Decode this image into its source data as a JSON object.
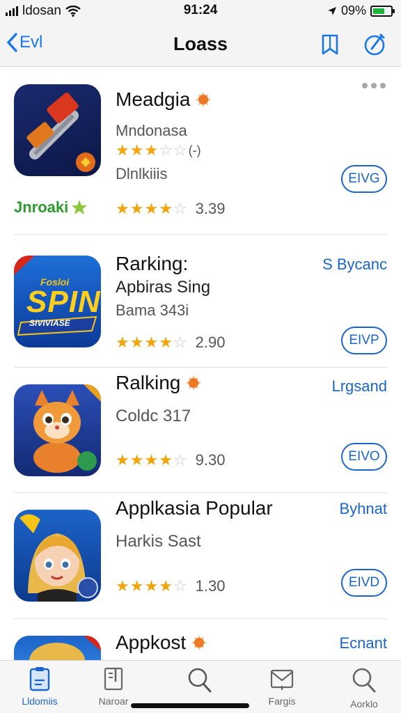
{
  "status_bar": {
    "carrier": "ldosan",
    "time": "91:24",
    "battery": "09%",
    "battery_level": 0.65
  },
  "nav": {
    "back_label": "Evl",
    "title": "Loass",
    "book_icon": "book-icon",
    "compose_icon": "compose-icon"
  },
  "apps": [
    {
      "name": "Meadgia",
      "subtitle": "Mndonasa",
      "small_rating_suffix": "(-)",
      "small_stars": 3,
      "category": "Dlnlkiiis",
      "stars": 4,
      "rating": "3.39",
      "button": "EIVG",
      "brand": "Jnroaki",
      "accent": "#e06a1b"
    },
    {
      "name": "Rarking:",
      "subtitle": "Apbiras Sing",
      "detail": "Bama 343i",
      "stars": 4,
      "rating": "2.90",
      "button": "EIVP",
      "side_link": "S Bycanc",
      "icon_text_top": "Fosloi",
      "icon_text_main": "SPIN",
      "icon_text_bottom": "SIVIVIASE"
    },
    {
      "name": "Ralking",
      "subtitle": "Coldc 317",
      "stars": 4,
      "rating": "9.30",
      "button": "EIVO",
      "side_link": "Lrgsand"
    },
    {
      "name": "Applkasia Popular",
      "subtitle": "Harkis Sast",
      "stars": 4,
      "rating": "1.30",
      "button": "EIVD",
      "side_link": "Byhnat"
    },
    {
      "name": "Appkost",
      "side_link": "Ecnant"
    }
  ],
  "tabs": [
    {
      "label": "Lldomiis",
      "icon": "clipboard-icon",
      "active": true
    },
    {
      "label": "Naroar",
      "icon": "document-icon",
      "active": false
    },
    {
      "label": "",
      "icon": "search-icon",
      "active": false
    },
    {
      "label": "Fargis",
      "icon": "inbox-icon",
      "active": false
    },
    {
      "label": "Aorklo",
      "icon": "search-icon",
      "active": false
    }
  ],
  "colors": {
    "accent": "#1877e6",
    "star": "#f2a40c",
    "brand_green": "#2d9a2d"
  }
}
